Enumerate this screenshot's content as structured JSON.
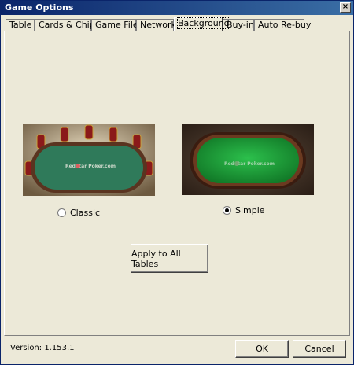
{
  "window": {
    "title": "Game Options",
    "close_glyph": "×"
  },
  "tabs": [
    {
      "label": "Table",
      "active": false
    },
    {
      "label": "Cards & Chips",
      "active": false
    },
    {
      "label": "Game Files",
      "active": false
    },
    {
      "label": "Network",
      "active": false
    },
    {
      "label": "Background",
      "active": true
    },
    {
      "label": "Buy-in",
      "active": false
    },
    {
      "label": "Auto Re-buy",
      "active": false
    }
  ],
  "backgrounds": [
    {
      "label": "Classic",
      "selected": false,
      "logo_text": "RedStar Poker.com"
    },
    {
      "label": "Simple",
      "selected": true,
      "logo_text": "RedStar Poker.com"
    }
  ],
  "apply_button": "Apply to All Tables",
  "footer": {
    "version": "Version: 1.153.1",
    "ok": "OK",
    "cancel": "Cancel"
  },
  "colors": {
    "felt_classic": "#2f7a5a",
    "felt_simple": "#1fa13c",
    "rail": "#4b2a1a"
  }
}
